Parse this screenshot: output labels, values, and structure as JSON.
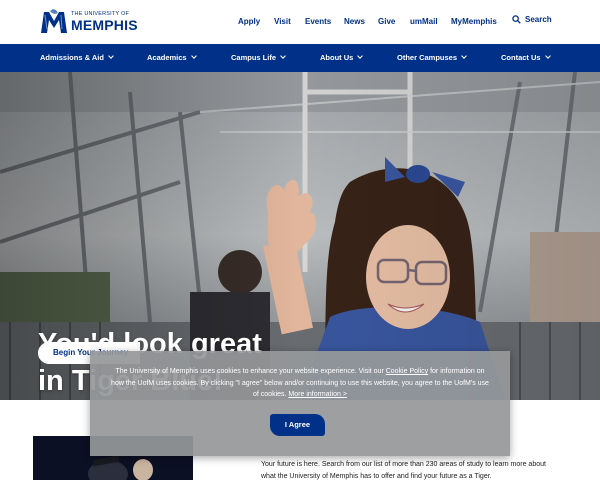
{
  "header": {
    "logo_small": "THE UNIVERSITY OF",
    "logo_big": "MEMPHIS",
    "logo_icon": "tiger-m-logo-icon",
    "links": [
      "Apply",
      "Visit",
      "Events",
      "News",
      "Give",
      "umMail",
      "MyMemphis"
    ],
    "search_label": "Search"
  },
  "nav": {
    "items": [
      "Admissions & Aid",
      "Academics",
      "Campus Life",
      "About Us",
      "Other Campuses",
      "Contact Us"
    ]
  },
  "hero": {
    "headline_line1": "You'd look great",
    "headline_line2": "in Tiger Blue!",
    "button_label": "Begin Your Journey"
  },
  "cookie": {
    "text1": "The University of Memphis uses cookies to enhance your website experience. Visit our ",
    "policy_link": "Cookie Policy",
    "text2": " for information on how the UofM uses cookies. By clicking \"I agree\" below and/or continuing to use this website, you agree to the UofM's use of cookies. ",
    "more_link": "More information >",
    "agree_label": "I Agree"
  },
  "lower": {
    "text": "Your future is here. Search from our list of more than 230 areas of study to learn more about what the University of Memphis has to offer and find your future as a Tiger."
  },
  "colors": {
    "brand_blue": "#003087",
    "white": "#ffffff",
    "cookie_gray": "#96989a"
  }
}
